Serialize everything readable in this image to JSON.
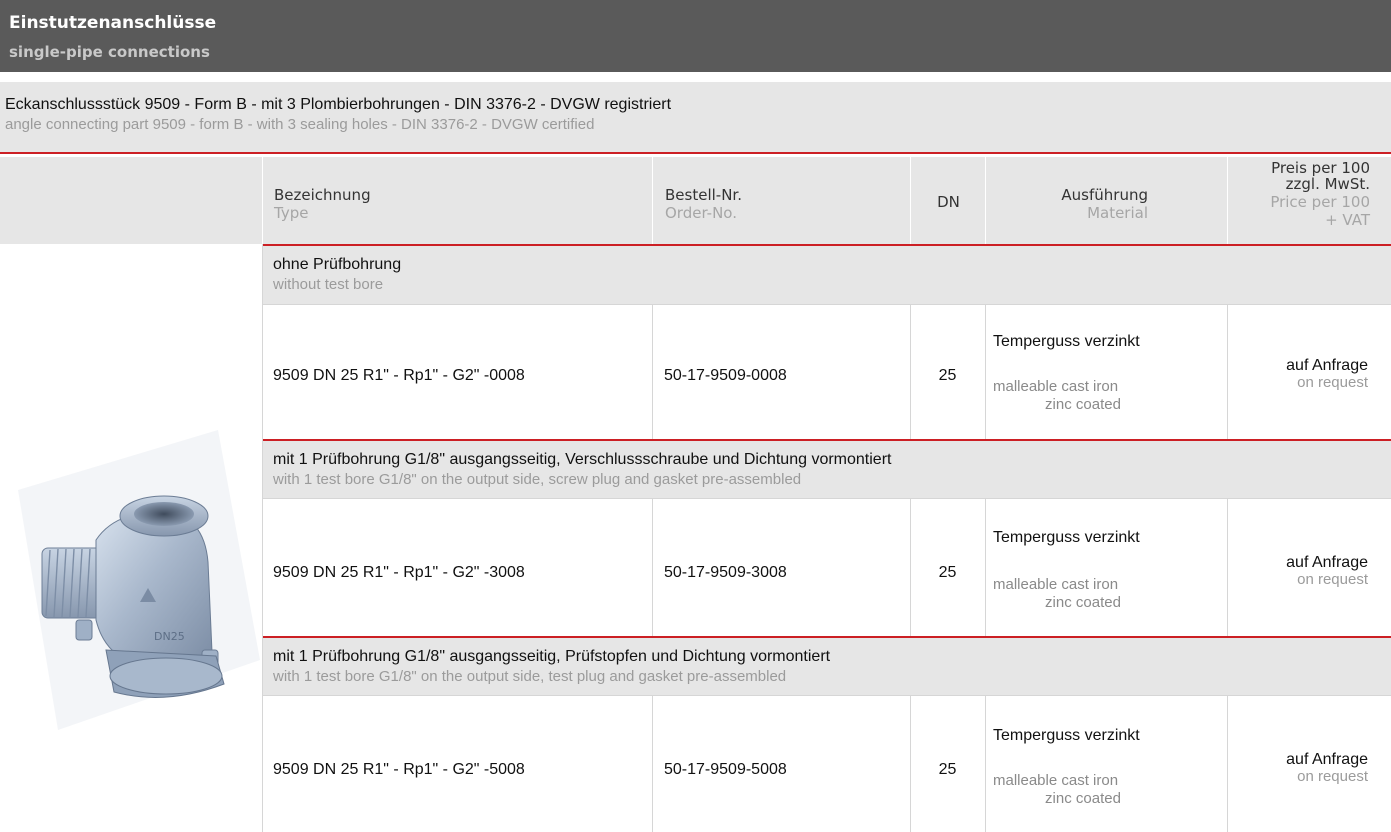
{
  "header": {
    "title_de": "Einstutzenanschlüsse",
    "title_en": "single-pipe connections"
  },
  "product": {
    "desc_de": "Eckanschlussstück 9509 - Form B - mit 3 Plombierbohrungen - DIN 3376-2 - DVGW registriert",
    "desc_en": "angle connecting part 9509 - form B - with 3 sealing holes - DIN 3376-2 - DVGW certified"
  },
  "columns": {
    "type_de": "Bezeichnung",
    "type_en": "Type",
    "order_de": "Bestell-Nr.",
    "order_en": "Order-No.",
    "dn": "DN",
    "material_de": "Ausführung",
    "material_en": "Material",
    "price_de_1": "Preis per 100",
    "price_de_2": "zzgl. MwSt.",
    "price_en_1": "Price per 100",
    "price_en_2": "+ VAT"
  },
  "groups": [
    {
      "title_de": "ohne Prüfbohrung",
      "title_en": "without test bore",
      "row": {
        "type": "9509 DN 25 R1\" - Rp1\" - G2\" -0008",
        "order": "50-17-9509-0008",
        "dn": "25",
        "material_de": "Temperguss verzinkt",
        "material_en_1": "malleable cast iron",
        "material_en_2": "zinc coated",
        "price_de": "auf Anfrage",
        "price_en": "on request"
      }
    },
    {
      "title_de": "mit 1 Prüfbohrung G1/8\" ausgangsseitig, Verschlussschraube und Dichtung vormontiert",
      "title_en": "with 1 test bore G1/8\" on the output side, screw plug and gasket pre-assembled",
      "row": {
        "type": "9509 DN 25 R1\" - Rp1\" - G2\" -3008",
        "order": "50-17-9509-3008",
        "dn": "25",
        "material_de": "Temperguss verzinkt",
        "material_en_1": "malleable cast iron",
        "material_en_2": "zinc coated",
        "price_de": "auf Anfrage",
        "price_en": "on request"
      }
    },
    {
      "title_de": "mit 1 Prüfbohrung G1/8\" ausgangsseitig, Prüfstopfen und Dichtung vormontiert",
      "title_en": "with 1 test bore G1/8\" on the output side, test plug and gasket pre-assembled",
      "row": {
        "type": "9509 DN 25 R1\" - Rp1\" - G2\" -5008",
        "order": "50-17-9509-5008",
        "dn": "25",
        "material_de": "Temperguss verzinkt",
        "material_en_1": "malleable cast iron",
        "material_en_2": "zinc coated",
        "price_de": "auf Anfrage",
        "price_en": "on request"
      }
    }
  ],
  "image": {
    "icon": "pipe-fitting-photo"
  }
}
